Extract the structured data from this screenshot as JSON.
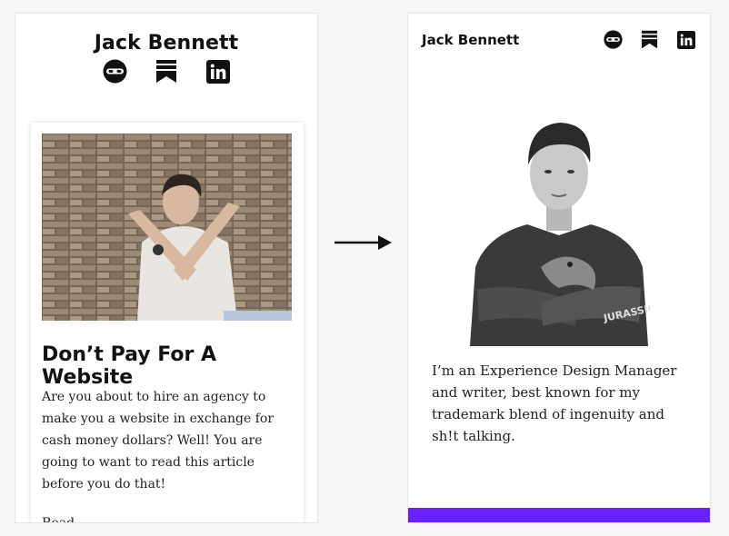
{
  "left": {
    "header_name": "Jack Bennett",
    "icons": [
      "ninja-icon",
      "bookmark-icon",
      "linkedin-icon"
    ],
    "card": {
      "title": "Don’t Pay For A Website",
      "body": "Are you about to hire an agency to make you a website in exchange for cash money dollars? Well! You are going to want to read this article before you do that!",
      "more_label": "Read..."
    }
  },
  "right": {
    "header_name": "Jack Bennett",
    "icons": [
      "ninja-icon",
      "bookmark-icon",
      "linkedin-icon"
    ],
    "bio": "I’m an Experience Design Manager and writer, best known for my trademark blend of ingenuity and sh!t talking.",
    "portrait_shirt_text": "JURASSIC"
  },
  "colors": {
    "background": "#f6f6f6",
    "accent_purple": "#6b21ff",
    "text": "#111111"
  }
}
